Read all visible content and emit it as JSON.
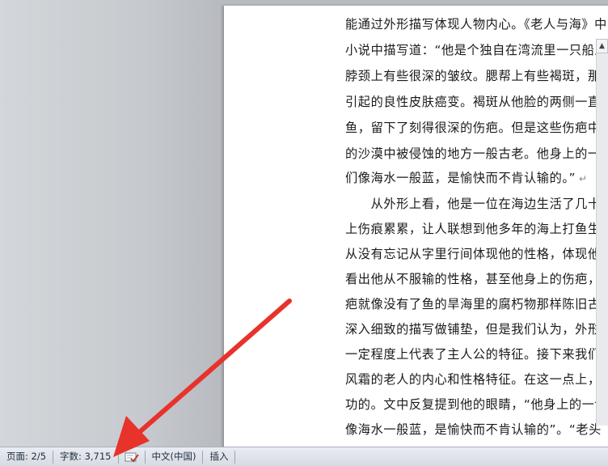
{
  "document": {
    "lines": [
      "能通过外形描写体现人物内心。《老人与海》中，",
      "小说中描写道：“他是个独自在湾流里一只船上",
      "脖颈上有些很深的皱纹。腮帮上有些褐斑，那是",
      "引起的良性皮肤癌变。褐斑从他脸的两侧一直",
      "鱼，留下了刻得很深的伤疤。但是这些伤疤中",
      "的沙漠中被侵蚀的地方一般古老。他身上的一",
      "们像海水一般蓝，是愉快而不肯认输的。”",
      "　　从外形上看，他是一位在海边生活了几十",
      "上伤痕累累，让人联想到他多年的海上打鱼生",
      "从没有忘记从字里行间体现他的性格，体现他",
      "看出他从不服输的性格，甚至他身上的伤疤，",
      "疤就像没有了鱼的旱海里的腐朽物那样陈旧古",
      "深入细致的描写做铺垫，但是我们认为，外形",
      "一定程度上代表了主人公的特征。接下来我们",
      "风霜的老人的内心和性格特征。在这一点上，",
      "功的。文中反复提到他的眼睛，“他身上的一切",
      "像海水一般蓝，是愉快而不肯认输的”。“老头"
    ],
    "paragraph_mark": "↵"
  },
  "statusbar": {
    "page": "页面: 2/5",
    "wordcount": "字数: 3,715",
    "language": "中文(中国)",
    "insert_mode": "插入"
  },
  "icons": {
    "proofing": "proofing-check-icon",
    "arrow": "red-arrow-annotation"
  },
  "colors": {
    "arrow": "#e8322c",
    "squiggle": "#4caf50"
  }
}
